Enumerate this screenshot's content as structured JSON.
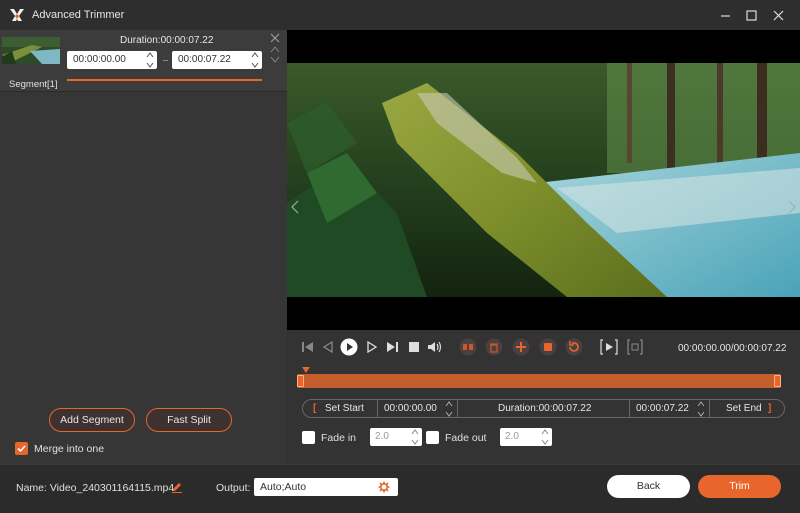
{
  "window": {
    "title": "Advanced Trimmer",
    "controls": [
      "minimize-icon",
      "maximize-icon",
      "close-icon"
    ]
  },
  "segment_list": {
    "segments": [
      {
        "label": "Segment[1]",
        "duration": "Duration:00:00:07.22",
        "start": "00:00:00.00",
        "end": "00:00:07.22"
      }
    ]
  },
  "left_actions": {
    "add_segment": "Add Segment",
    "fast_split": "Fast Split",
    "merge_label": "Merge into one",
    "merge_checked": true
  },
  "playback": {
    "time_readout": "00:00:00.00/00:00:07.22",
    "icons": [
      "skip-to-start-icon",
      "prev-frame-icon",
      "play-icon",
      "next-frame-icon",
      "skip-to-end-icon",
      "stop-icon",
      "volume-icon",
      "split-icon",
      "delete-icon",
      "add-icon",
      "copy-icon",
      "reset-icon",
      "play-segment-icon",
      "fullscreen-icon"
    ]
  },
  "trim": {
    "set_start": "Set Start",
    "start_time": "00:00:00.00",
    "duration": "Duration:00:00:07.22",
    "end_time": "00:00:07.22",
    "set_end": "Set End",
    "bracket_open": "[",
    "bracket_close": "]",
    "selection_start_fraction": 0,
    "selection_end_fraction": 1
  },
  "fade": {
    "fade_in_label": "Fade in",
    "fade_in_value": "2.0",
    "fade_out_label": "Fade out",
    "fade_out_value": "2.0"
  },
  "footer": {
    "name_label": "Name:",
    "file_name": "Video_240301164115.mp4",
    "output_label": "Output:",
    "output_value": "Auto;Auto",
    "back": "Back",
    "trim": "Trim"
  },
  "colors": {
    "accent": "#e8652b",
    "panel": "#363636",
    "background": "#2b2b2b"
  }
}
